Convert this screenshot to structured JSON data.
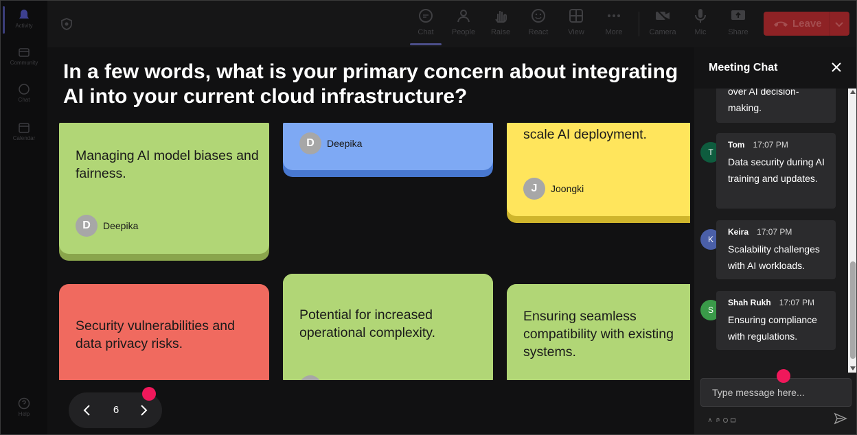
{
  "rail": {
    "items": [
      {
        "label": "Activity"
      },
      {
        "label": "Community"
      },
      {
        "label": "Chat"
      },
      {
        "label": "Calendar"
      },
      {
        "label": "Help"
      }
    ]
  },
  "toolbar": {
    "items": [
      {
        "label": "Chat"
      },
      {
        "label": "People"
      },
      {
        "label": "Raise"
      },
      {
        "label": "React"
      },
      {
        "label": "View"
      },
      {
        "label": "More"
      },
      {
        "label": "Camera"
      },
      {
        "label": "Mic"
      },
      {
        "label": "Share"
      }
    ],
    "leave_label": "Leave"
  },
  "question": "In a few words, what is your primary concern about integrating AI into your current cloud infrastructure?",
  "cards": [
    {
      "text": "Managing AI model biases and fairness.",
      "author": "Deepika",
      "initial": "D",
      "color": "green"
    },
    {
      "text": "",
      "author": "Deepika",
      "initial": "D",
      "color": "blue"
    },
    {
      "text": "scale AI deployment.",
      "author": "Joongki",
      "initial": "J",
      "color": "yellow"
    },
    {
      "text": "Security vulnerabilities and data privacy risks.",
      "color": "red"
    },
    {
      "text": "Potential for increased operational complexity.",
      "color": "green"
    },
    {
      "text": "Ensuring seamless compatibility with existing systems.",
      "color": "green"
    }
  ],
  "pager": {
    "page": "6"
  },
  "chat": {
    "title": "Meeting Chat",
    "partial_message": "over AI decision-\nmaking.",
    "messages": [
      {
        "name": "Tom",
        "time": "17:07 PM",
        "initial": "T",
        "avatar_color": "#0e5c3e",
        "text": "Data security during AI training and updates."
      },
      {
        "name": "Keira",
        "time": "17:07 PM",
        "initial": "K",
        "avatar_color": "#4a5fa8",
        "text": "Scalability challenges with AI workloads."
      },
      {
        "name": "Shah Rukh",
        "time": "17:07 PM",
        "initial": "S",
        "avatar_color": "#3a9a49",
        "text": "Ensuring compliance with regulations."
      }
    ],
    "input_placeholder": "Type message here..."
  }
}
